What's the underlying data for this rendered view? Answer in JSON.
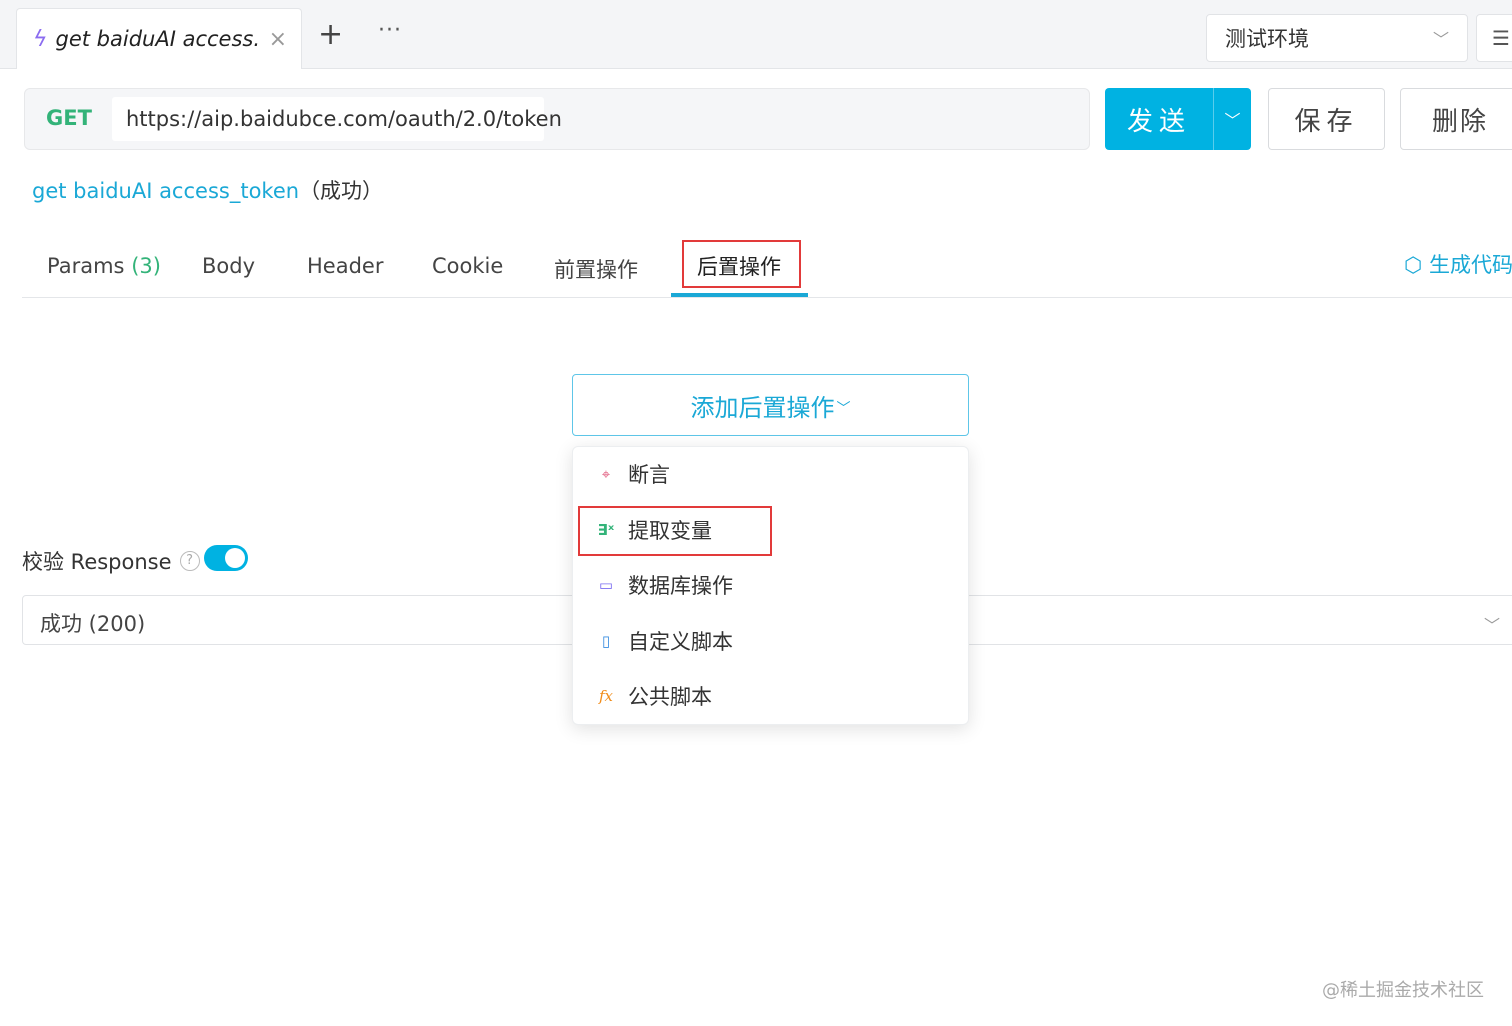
{
  "tab": {
    "title": "get baiduAI access...",
    "close": "×"
  },
  "tabbar": {
    "plus": "+",
    "more": "···"
  },
  "environment": {
    "selected": "测试环境"
  },
  "request": {
    "method": "GET",
    "url": "https://aip.baidubce.com/oauth/2.0/token",
    "send_label": "发送",
    "save_label": "保存",
    "delete_label": "删除"
  },
  "api": {
    "name": "get baiduAI access_token",
    "status": "（成功）"
  },
  "subtabs": {
    "params": "Params",
    "params_count": "(3)",
    "body": "Body",
    "header": "Header",
    "cookie": "Cookie",
    "pre": "前置操作",
    "post": "后置操作",
    "generate_code": "生成代码"
  },
  "post_ops": {
    "add_label": "添加后置操作",
    "menu": [
      "断言",
      "提取变量",
      "数据库操作",
      "自定义脚本",
      "公共脚本"
    ]
  },
  "verify": {
    "label": "校验 Response",
    "help": "?",
    "enabled": true,
    "response_selected": "成功 (200)"
  },
  "watermark": "@稀土掘金技术社区",
  "colors": {
    "accent": "#00b2e2",
    "method_get": "#33b379",
    "highlight_box": "#e23a3a"
  }
}
